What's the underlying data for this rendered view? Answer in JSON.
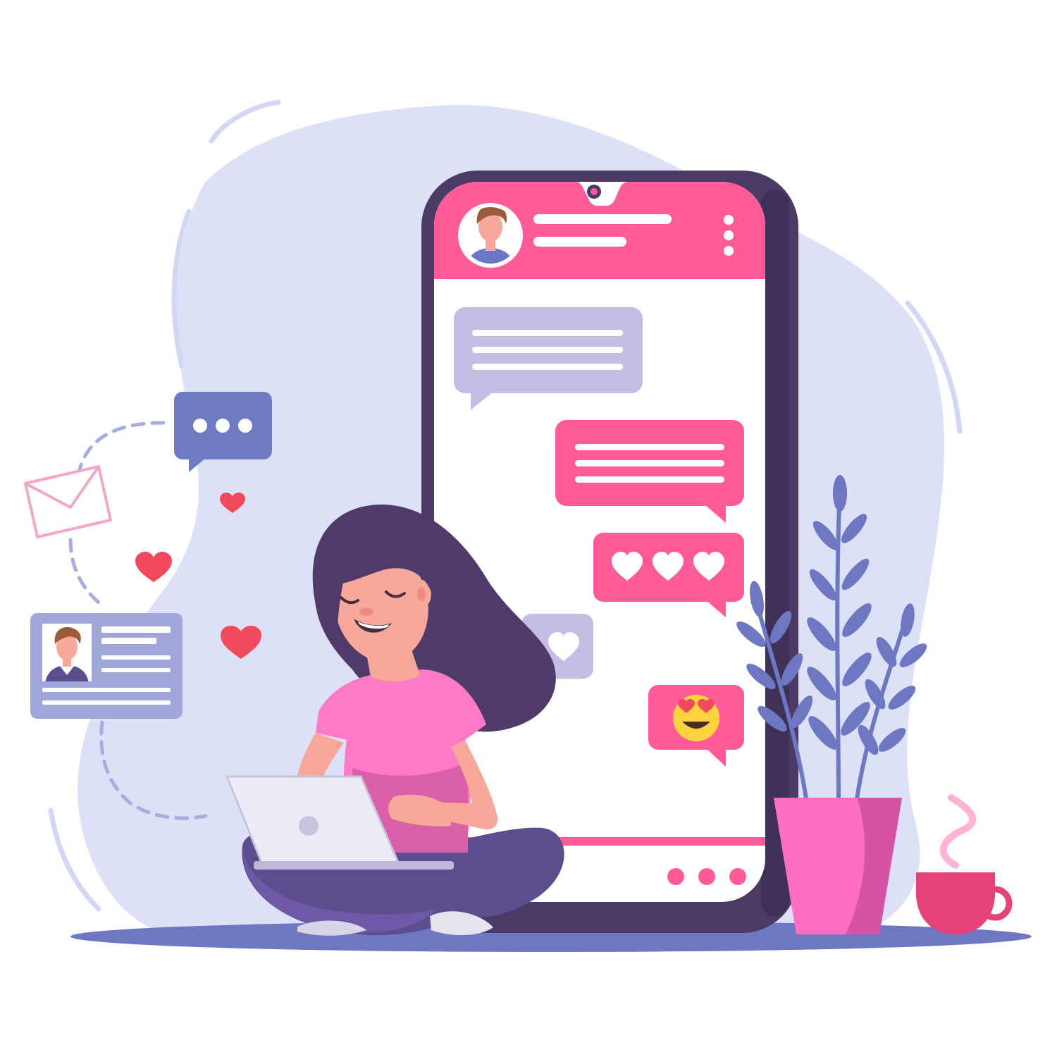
{
  "colors": {
    "background": "#ffffff",
    "blob": "#dde1f7",
    "floor_shadow": "#6e77c2",
    "phone_body": "#4a3a65",
    "phone_screen": "#ffffff",
    "accent_pink": "#ff5b99",
    "received_bubble": "#c5bde5",
    "chat_bubble_icon": "#6e7bc4",
    "heart_red": "#f04a5c",
    "plant_leaf": "#6e77c2",
    "pot_pink": "#ff6fc1",
    "cup_pink": "#e5427a",
    "steam_pink": "#ffb3d6",
    "hair": "#4f3a6a",
    "shirt": "#ff7ac5",
    "skin": "#f7a89a",
    "pants": "#5b4d8e",
    "laptop": "#ecebf6"
  },
  "icons": {
    "contact_avatar": "avatar-icon",
    "menu": "more-vertical-icon",
    "typing_bubble": "chat-typing-icon",
    "envelope": "envelope-icon",
    "profile_card": "profile-card-icon",
    "hearts": "heart-icon",
    "emoji": "heart-eyes-emoji-icon",
    "nav_dots": "more-horizontal-icon"
  }
}
